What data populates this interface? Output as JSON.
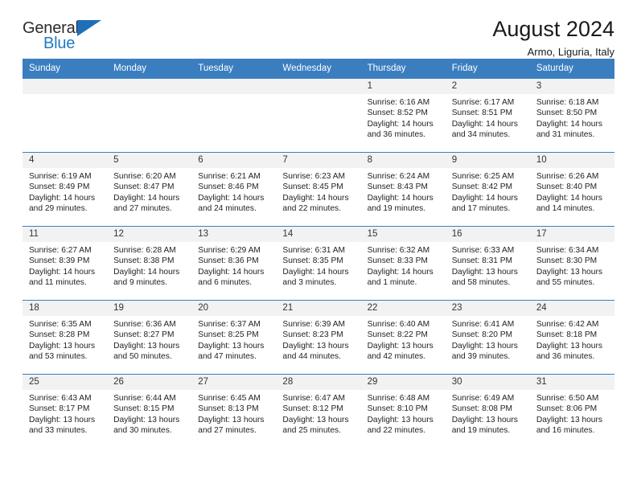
{
  "brand": {
    "name_part1": "General",
    "name_part2": "Blue",
    "flag_icon": "flag-triangle-icon"
  },
  "header": {
    "title": "August 2024",
    "location": "Armo, Liguria, Italy"
  },
  "weekday_headers": [
    "Sunday",
    "Monday",
    "Tuesday",
    "Wednesday",
    "Thursday",
    "Friday",
    "Saturday"
  ],
  "colors": {
    "header_blue": "#3a7ec0",
    "brand_blue": "#1f7ac0",
    "daynum_bg": "#f2f2f2"
  },
  "weeks": [
    [
      {
        "day": "",
        "empty": true,
        "line1": "",
        "line2": "",
        "line3": "",
        "line4": ""
      },
      {
        "day": "",
        "empty": true,
        "line1": "",
        "line2": "",
        "line3": "",
        "line4": ""
      },
      {
        "day": "",
        "empty": true,
        "line1": "",
        "line2": "",
        "line3": "",
        "line4": ""
      },
      {
        "day": "",
        "empty": true,
        "line1": "",
        "line2": "",
        "line3": "",
        "line4": ""
      },
      {
        "day": "1",
        "empty": false,
        "line1": "Sunrise: 6:16 AM",
        "line2": "Sunset: 8:52 PM",
        "line3": "Daylight: 14 hours",
        "line4": "and 36 minutes."
      },
      {
        "day": "2",
        "empty": false,
        "line1": "Sunrise: 6:17 AM",
        "line2": "Sunset: 8:51 PM",
        "line3": "Daylight: 14 hours",
        "line4": "and 34 minutes."
      },
      {
        "day": "3",
        "empty": false,
        "line1": "Sunrise: 6:18 AM",
        "line2": "Sunset: 8:50 PM",
        "line3": "Daylight: 14 hours",
        "line4": "and 31 minutes."
      }
    ],
    [
      {
        "day": "4",
        "empty": false,
        "line1": "Sunrise: 6:19 AM",
        "line2": "Sunset: 8:49 PM",
        "line3": "Daylight: 14 hours",
        "line4": "and 29 minutes."
      },
      {
        "day": "5",
        "empty": false,
        "line1": "Sunrise: 6:20 AM",
        "line2": "Sunset: 8:47 PM",
        "line3": "Daylight: 14 hours",
        "line4": "and 27 minutes."
      },
      {
        "day": "6",
        "empty": false,
        "line1": "Sunrise: 6:21 AM",
        "line2": "Sunset: 8:46 PM",
        "line3": "Daylight: 14 hours",
        "line4": "and 24 minutes."
      },
      {
        "day": "7",
        "empty": false,
        "line1": "Sunrise: 6:23 AM",
        "line2": "Sunset: 8:45 PM",
        "line3": "Daylight: 14 hours",
        "line4": "and 22 minutes."
      },
      {
        "day": "8",
        "empty": false,
        "line1": "Sunrise: 6:24 AM",
        "line2": "Sunset: 8:43 PM",
        "line3": "Daylight: 14 hours",
        "line4": "and 19 minutes."
      },
      {
        "day": "9",
        "empty": false,
        "line1": "Sunrise: 6:25 AM",
        "line2": "Sunset: 8:42 PM",
        "line3": "Daylight: 14 hours",
        "line4": "and 17 minutes."
      },
      {
        "day": "10",
        "empty": false,
        "line1": "Sunrise: 6:26 AM",
        "line2": "Sunset: 8:40 PM",
        "line3": "Daylight: 14 hours",
        "line4": "and 14 minutes."
      }
    ],
    [
      {
        "day": "11",
        "empty": false,
        "line1": "Sunrise: 6:27 AM",
        "line2": "Sunset: 8:39 PM",
        "line3": "Daylight: 14 hours",
        "line4": "and 11 minutes."
      },
      {
        "day": "12",
        "empty": false,
        "line1": "Sunrise: 6:28 AM",
        "line2": "Sunset: 8:38 PM",
        "line3": "Daylight: 14 hours",
        "line4": "and 9 minutes."
      },
      {
        "day": "13",
        "empty": false,
        "line1": "Sunrise: 6:29 AM",
        "line2": "Sunset: 8:36 PM",
        "line3": "Daylight: 14 hours",
        "line4": "and 6 minutes."
      },
      {
        "day": "14",
        "empty": false,
        "line1": "Sunrise: 6:31 AM",
        "line2": "Sunset: 8:35 PM",
        "line3": "Daylight: 14 hours",
        "line4": "and 3 minutes."
      },
      {
        "day": "15",
        "empty": false,
        "line1": "Sunrise: 6:32 AM",
        "line2": "Sunset: 8:33 PM",
        "line3": "Daylight: 14 hours",
        "line4": "and 1 minute."
      },
      {
        "day": "16",
        "empty": false,
        "line1": "Sunrise: 6:33 AM",
        "line2": "Sunset: 8:31 PM",
        "line3": "Daylight: 13 hours",
        "line4": "and 58 minutes."
      },
      {
        "day": "17",
        "empty": false,
        "line1": "Sunrise: 6:34 AM",
        "line2": "Sunset: 8:30 PM",
        "line3": "Daylight: 13 hours",
        "line4": "and 55 minutes."
      }
    ],
    [
      {
        "day": "18",
        "empty": false,
        "line1": "Sunrise: 6:35 AM",
        "line2": "Sunset: 8:28 PM",
        "line3": "Daylight: 13 hours",
        "line4": "and 53 minutes."
      },
      {
        "day": "19",
        "empty": false,
        "line1": "Sunrise: 6:36 AM",
        "line2": "Sunset: 8:27 PM",
        "line3": "Daylight: 13 hours",
        "line4": "and 50 minutes."
      },
      {
        "day": "20",
        "empty": false,
        "line1": "Sunrise: 6:37 AM",
        "line2": "Sunset: 8:25 PM",
        "line3": "Daylight: 13 hours",
        "line4": "and 47 minutes."
      },
      {
        "day": "21",
        "empty": false,
        "line1": "Sunrise: 6:39 AM",
        "line2": "Sunset: 8:23 PM",
        "line3": "Daylight: 13 hours",
        "line4": "and 44 minutes."
      },
      {
        "day": "22",
        "empty": false,
        "line1": "Sunrise: 6:40 AM",
        "line2": "Sunset: 8:22 PM",
        "line3": "Daylight: 13 hours",
        "line4": "and 42 minutes."
      },
      {
        "day": "23",
        "empty": false,
        "line1": "Sunrise: 6:41 AM",
        "line2": "Sunset: 8:20 PM",
        "line3": "Daylight: 13 hours",
        "line4": "and 39 minutes."
      },
      {
        "day": "24",
        "empty": false,
        "line1": "Sunrise: 6:42 AM",
        "line2": "Sunset: 8:18 PM",
        "line3": "Daylight: 13 hours",
        "line4": "and 36 minutes."
      }
    ],
    [
      {
        "day": "25",
        "empty": false,
        "line1": "Sunrise: 6:43 AM",
        "line2": "Sunset: 8:17 PM",
        "line3": "Daylight: 13 hours",
        "line4": "and 33 minutes."
      },
      {
        "day": "26",
        "empty": false,
        "line1": "Sunrise: 6:44 AM",
        "line2": "Sunset: 8:15 PM",
        "line3": "Daylight: 13 hours",
        "line4": "and 30 minutes."
      },
      {
        "day": "27",
        "empty": false,
        "line1": "Sunrise: 6:45 AM",
        "line2": "Sunset: 8:13 PM",
        "line3": "Daylight: 13 hours",
        "line4": "and 27 minutes."
      },
      {
        "day": "28",
        "empty": false,
        "line1": "Sunrise: 6:47 AM",
        "line2": "Sunset: 8:12 PM",
        "line3": "Daylight: 13 hours",
        "line4": "and 25 minutes."
      },
      {
        "day": "29",
        "empty": false,
        "line1": "Sunrise: 6:48 AM",
        "line2": "Sunset: 8:10 PM",
        "line3": "Daylight: 13 hours",
        "line4": "and 22 minutes."
      },
      {
        "day": "30",
        "empty": false,
        "line1": "Sunrise: 6:49 AM",
        "line2": "Sunset: 8:08 PM",
        "line3": "Daylight: 13 hours",
        "line4": "and 19 minutes."
      },
      {
        "day": "31",
        "empty": false,
        "line1": "Sunrise: 6:50 AM",
        "line2": "Sunset: 8:06 PM",
        "line3": "Daylight: 13 hours",
        "line4": "and 16 minutes."
      }
    ]
  ]
}
